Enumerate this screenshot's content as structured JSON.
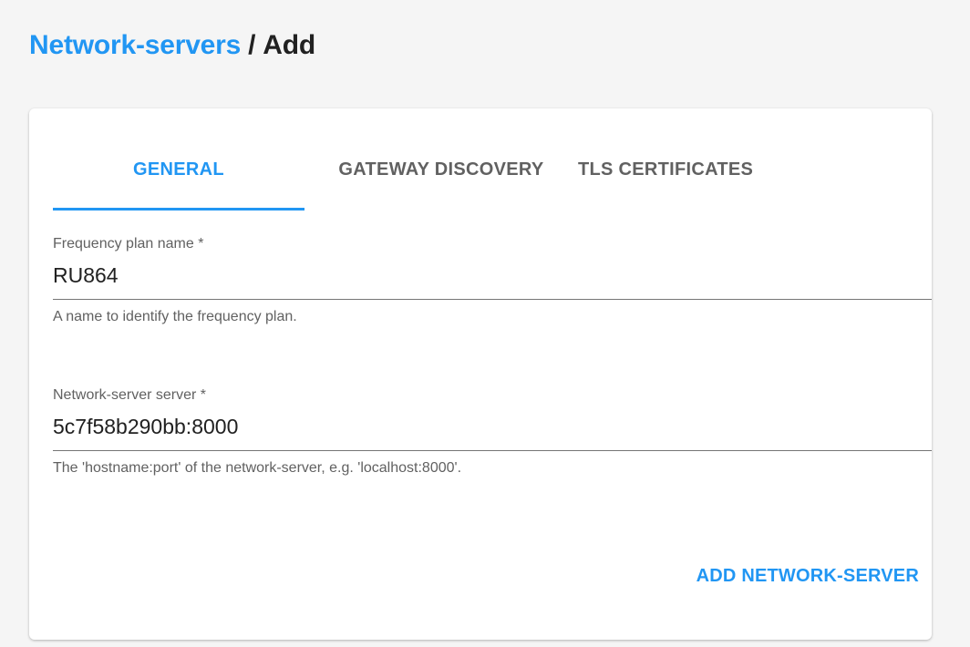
{
  "breadcrumb": {
    "parent": "Network-servers",
    "separator": "/",
    "current": "Add"
  },
  "tabs": [
    {
      "label": "GENERAL",
      "active": true
    },
    {
      "label": "GATEWAY DISCOVERY",
      "active": false
    },
    {
      "label": "TLS CERTIFICATES",
      "active": false
    }
  ],
  "form": {
    "name": {
      "label": "Frequency plan name *",
      "value": "RU864",
      "helper": "A name to identify the frequency plan."
    },
    "server": {
      "label": "Network-server server *",
      "value": "5c7f58b290bb:8000",
      "helper": "The 'hostname:port' of the network-server, e.g. 'localhost:8000'."
    },
    "submit_label": "ADD NETWORK-SERVER"
  },
  "colors": {
    "accent": "#2196f3",
    "background": "#f5f5f5",
    "card": "#ffffff",
    "text": "#212121",
    "muted": "#616161"
  }
}
